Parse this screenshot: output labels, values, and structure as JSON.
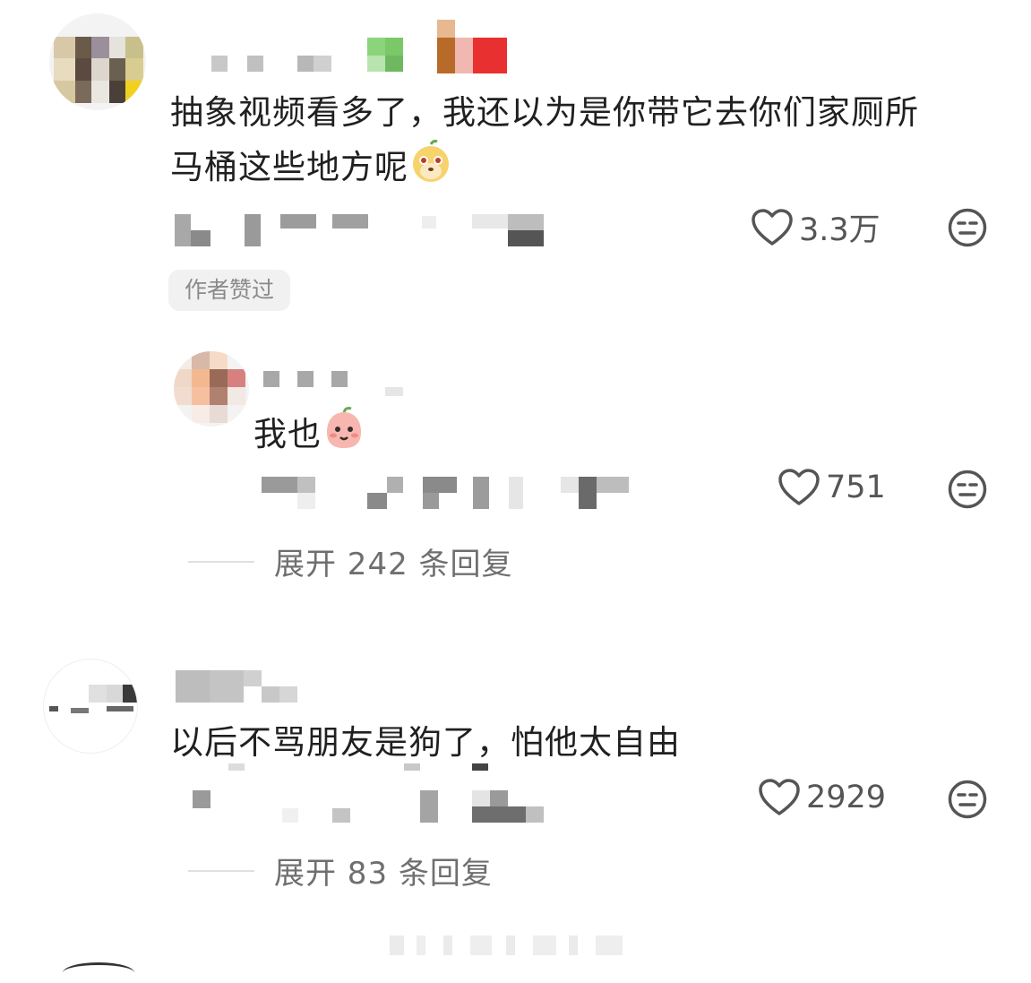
{
  "comments": [
    {
      "text_line1": "抽象视频看多了，我还以为是你带它去你们家厕所",
      "text_line2": "马桶这些地方呢",
      "emoji": "monkey-face-emoji",
      "likes": "3.3万",
      "author_tag": "作者赞过",
      "reply": {
        "text": "我也",
        "emoji": "pink-blob-emoji",
        "likes": "751"
      },
      "expand_label": "展开 242 条回复"
    },
    {
      "text": "以后不骂朋友是狗了，怕他太自由",
      "likes": "2929",
      "expand_label": "展开 83 条回复"
    }
  ],
  "icons": {
    "like": "heart-outline-icon",
    "dislike": "meh-face-icon"
  },
  "colors": {
    "text": "#202020",
    "meta": "#6f6f6f",
    "tag_bg": "#f1f1f1"
  }
}
